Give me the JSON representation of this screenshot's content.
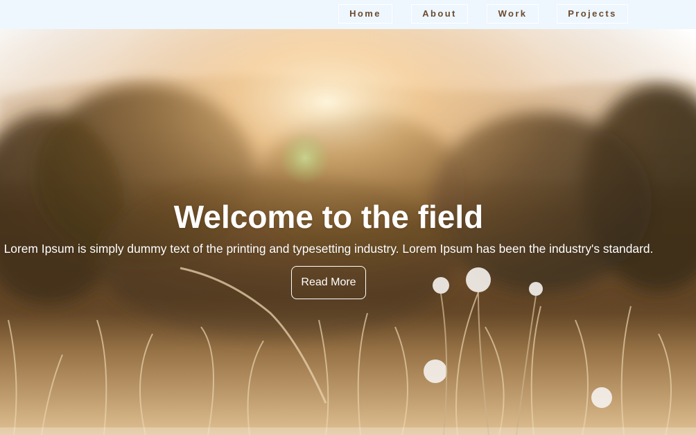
{
  "nav": {
    "items": [
      {
        "label": "Home"
      },
      {
        "label": "About"
      },
      {
        "label": "Work"
      },
      {
        "label": "Projects"
      }
    ]
  },
  "hero": {
    "title": "Welcome to the field",
    "text": "Lorem Ipsum is simply dummy text of the printing and typesetting industry. Lorem Ipsum has been the industry's standard.",
    "button_label": "Read More"
  },
  "colors": {
    "nav_background": "#eef6fe",
    "nav_text": "#6b4a2e",
    "hero_text": "#ffffff"
  }
}
